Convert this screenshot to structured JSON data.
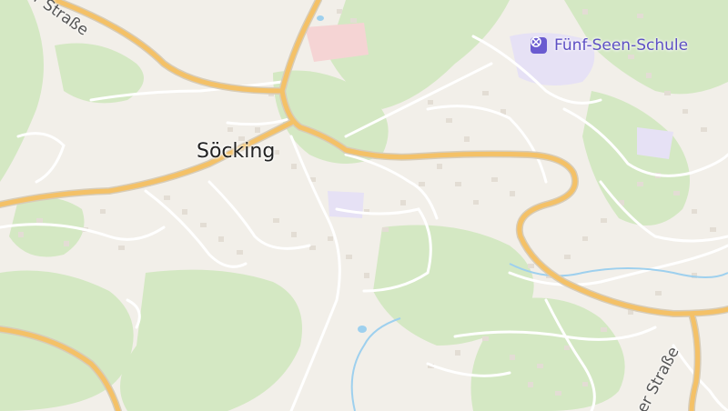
{
  "map": {
    "place_label": "Söcking",
    "poi": {
      "name": "Fünf-Seen-Schule",
      "icon": "school-icon"
    },
    "streets": [
      {
        "text": "er Straße"
      },
      {
        "text": "er Straße"
      }
    ],
    "colors": {
      "background": "#f2efe9",
      "forest": "#d4e8c3",
      "major_road": "#f4c167",
      "road_casing": "#d7ccb8",
      "minor_road": "#ffffff",
      "building": "#e3ddd4",
      "school_area": "#e6e1f5",
      "school_accent": "#6a5bd0",
      "hospital_area": "#f5d4d4",
      "stream": "#9ed0ee"
    }
  }
}
